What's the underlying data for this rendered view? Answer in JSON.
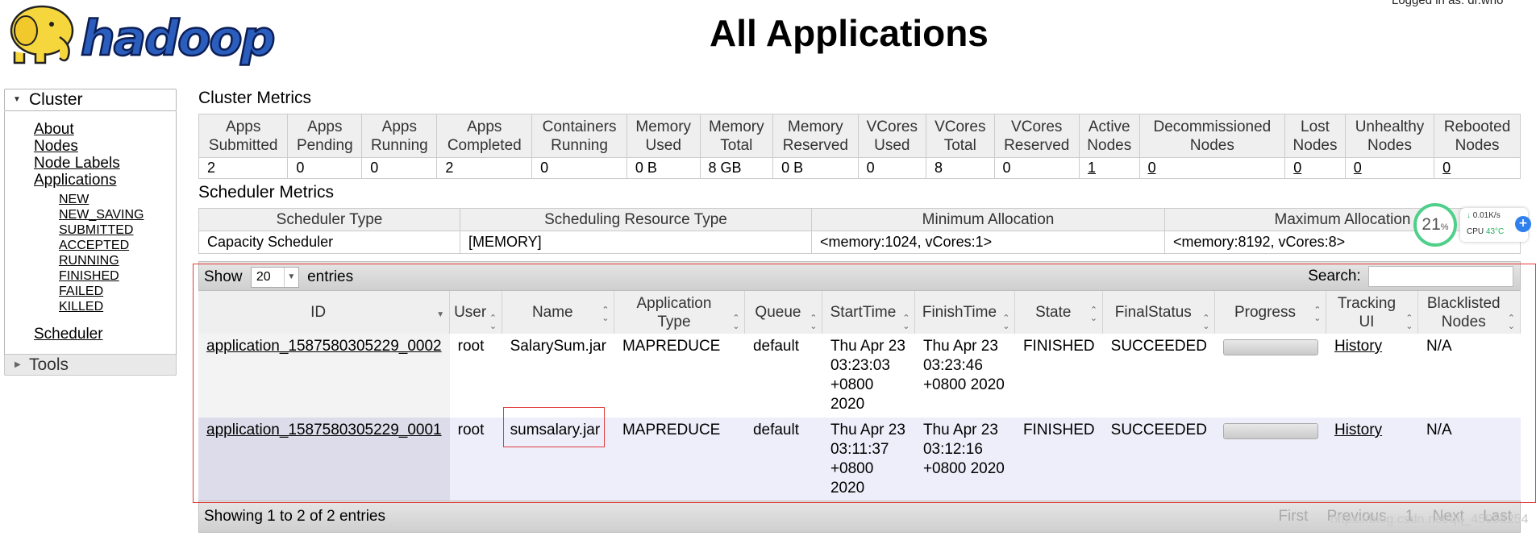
{
  "header": {
    "logo_text": "hadoop",
    "title": "All Applications",
    "logged_in": "Logged in as: dr.who"
  },
  "sidebar": {
    "cluster_label": "Cluster",
    "cluster_links": [
      "About",
      "Nodes",
      "Node Labels",
      "Applications"
    ],
    "app_states": [
      "NEW",
      "NEW_SAVING",
      "SUBMITTED",
      "ACCEPTED",
      "RUNNING",
      "FINISHED",
      "FAILED",
      "KILLED"
    ],
    "scheduler_link": "Scheduler",
    "tools_label": "Tools"
  },
  "cluster_metrics": {
    "title": "Cluster Metrics",
    "columns": [
      [
        "Apps",
        "Submitted"
      ],
      [
        "Apps",
        "Pending"
      ],
      [
        "Apps",
        "Running"
      ],
      [
        "Apps",
        "Completed"
      ],
      [
        "Containers",
        "Running"
      ],
      [
        "Memory",
        "Used"
      ],
      [
        "Memory",
        "Total"
      ],
      [
        "Memory",
        "Reserved"
      ],
      [
        "VCores",
        "Used"
      ],
      [
        "VCores",
        "Total"
      ],
      [
        "VCores",
        "Reserved"
      ],
      [
        "Active",
        "Nodes"
      ],
      [
        "Decommissioned",
        "Nodes"
      ],
      [
        "Lost",
        "Nodes"
      ],
      [
        "Unhealthy",
        "Nodes"
      ],
      [
        "Rebooted",
        "Nodes"
      ]
    ],
    "values": [
      "2",
      "0",
      "0",
      "2",
      "0",
      "0 B",
      "8 GB",
      "0 B",
      "0",
      "8",
      "0",
      "1",
      "0",
      "0",
      "0",
      "0"
    ]
  },
  "scheduler_metrics": {
    "title": "Scheduler Metrics",
    "columns": [
      "Scheduler Type",
      "Scheduling Resource Type",
      "Minimum Allocation",
      "Maximum Allocation"
    ],
    "values": [
      "Capacity Scheduler",
      "[MEMORY]",
      "<memory:1024, vCores:1>",
      "<memory:8192, vCores:8>"
    ]
  },
  "apps": {
    "show_label": "Show",
    "page_size": "20",
    "entries_label": "entries",
    "search_label": "Search:",
    "search_value": "",
    "columns": [
      [
        "ID"
      ],
      [
        "User"
      ],
      [
        "Name"
      ],
      [
        "Application",
        "Type"
      ],
      [
        "Queue"
      ],
      [
        "StartTime"
      ],
      [
        "FinishTime"
      ],
      [
        "State"
      ],
      [
        "FinalStatus"
      ],
      [
        "Progress"
      ],
      [
        "Tracking UI"
      ],
      [
        "Blacklisted",
        "Nodes"
      ]
    ],
    "rows": [
      {
        "id": "application_1587580305229_0002",
        "user": "root",
        "name": "SalarySum.jar",
        "type": "MAPREDUCE",
        "queue": "default",
        "start": [
          "Thu Apr 23",
          "03:23:03",
          "+0800",
          "2020"
        ],
        "finish": [
          "Thu Apr 23",
          "03:23:46",
          "+0800 2020"
        ],
        "state": "FINISHED",
        "final_status": "SUCCEEDED",
        "progress": 1.0,
        "tracking": "History",
        "blacklisted": "N/A"
      },
      {
        "id": "application_1587580305229_0001",
        "user": "root",
        "name": "sumsalary.jar",
        "type": "MAPREDUCE",
        "queue": "default",
        "start": [
          "Thu Apr 23",
          "03:11:37",
          "+0800",
          "2020"
        ],
        "finish": [
          "Thu Apr 23",
          "03:12:16",
          "+0800 2020"
        ],
        "state": "FINISHED",
        "final_status": "SUCCEEDED",
        "progress": 1.0,
        "tracking": "History",
        "blacklisted": "N/A"
      }
    ],
    "footer_info": "Showing 1 to 2 of 2 entries",
    "pager": [
      "First",
      "Previous",
      "1",
      "Next",
      "Last"
    ]
  },
  "overlay": {
    "cpu_percent": "21",
    "cpu_percent_sign": "%",
    "net_speed": "0.01K/s",
    "cpu_temp_label": "CPU",
    "cpu_temp": "43°C",
    "watermark": "https://blog.csdn.net/qq_45058254"
  },
  "colors": {
    "annotation": "#e03a3a",
    "row_even": "#eeeefa",
    "header_bg": "#efefef",
    "cpu_ring": "#4fd08a"
  }
}
